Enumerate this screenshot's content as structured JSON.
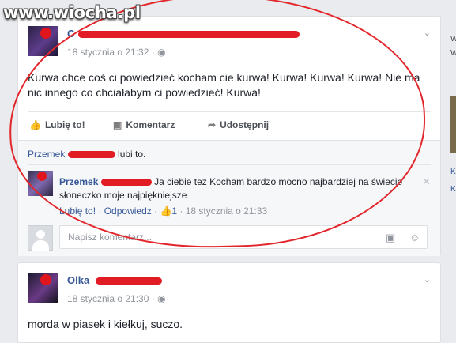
{
  "watermark": "www.wiocha.pl",
  "post1": {
    "author": "C",
    "timestamp": "18 stycznia o 21:32",
    "privacy_icon": "globe-icon",
    "menu_icon": "chevron-down-icon",
    "text": "Kurwa chce coś ci powiedzieć kocham cie kurwa! Kurwa! Kurwa! Kurwa! Nie ma nic innego co chciałabym ci powiedzieć! Kurwa!",
    "actions": {
      "like": "Lubię to!",
      "comment": "Komentarz",
      "share": "Udostępnij"
    },
    "likes": {
      "name": "Przemek",
      "suffix": "lubi to."
    },
    "comment": {
      "author": "Przemek",
      "text": "Ja ciebie tez Kocham bardzo mocno najbardziej na świecie słoneczko moje najpiękniejsze",
      "like_link": "Lubię to!",
      "reply_link": "Odpowiedz",
      "like_count": "1",
      "timestamp": "18 stycznia o 21:33"
    },
    "composer": {
      "placeholder": "Napisz komentarz..."
    }
  },
  "post2": {
    "author": "Olka",
    "timestamp": "18 stycznia o 21:30",
    "text": "morda w piasek i kiełkuj, suczo."
  },
  "sidebar": {
    "fragments": [
      "W",
      "W",
      "K",
      "K"
    ]
  },
  "colors": {
    "link": "#365899",
    "redaction": "#e21c24",
    "background": "#e9ebee"
  }
}
